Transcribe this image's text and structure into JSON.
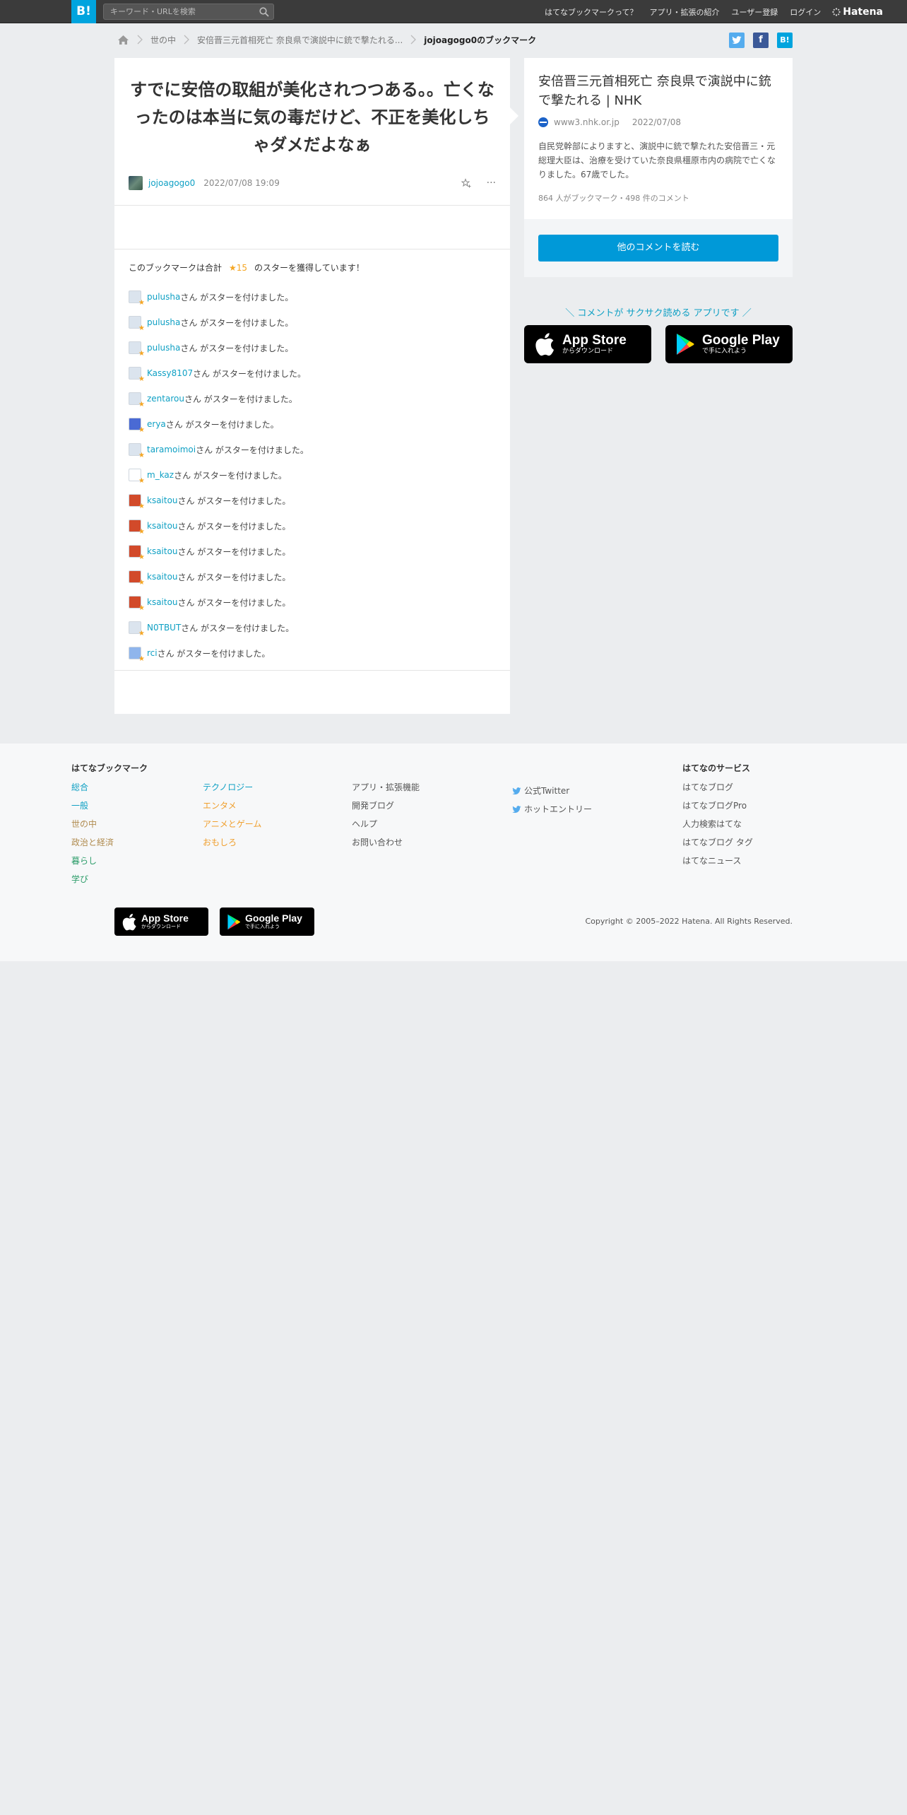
{
  "header": {
    "logo": "B!",
    "search_placeholder": "キーワード・URLを検索",
    "nav": [
      "はてなブックマークって？",
      "アプリ・拡張の紹介",
      "ユーザー登録",
      "ログイン"
    ],
    "brand": "Hatena"
  },
  "breadcrumb": {
    "items": [
      "世の中",
      "安倍晋三元首相死亡 奈良県で演説中に銃で撃たれる...",
      "jojoagogo0のブックマーク"
    ]
  },
  "share": {
    "twitter": "t",
    "facebook": "f",
    "hatena": "B!"
  },
  "bookmark": {
    "comment": "すでに安倍の取組が美化されつつある。。亡くなったのは本当に気の毒だけど、不正を美化しちゃダメだよなぁ",
    "user": "jojoagogo0",
    "date": "2022/07/08 19:09",
    "star_summary_pre": "このブックマークは合計",
    "star_count": "★15",
    "star_summary_post": "のスターを獲得しています！",
    "star_suffix": "さん がスターを付けました。",
    "stars": [
      {
        "user": "pulusha",
        "icon_color": "#dbe4ee"
      },
      {
        "user": "pulusha",
        "icon_color": "#dbe4ee"
      },
      {
        "user": "pulusha",
        "icon_color": "#dbe4ee"
      },
      {
        "user": "Kassy8107",
        "icon_color": "#dbe4ee"
      },
      {
        "user": "zentarou",
        "icon_color": "#dbe4ee"
      },
      {
        "user": "erya",
        "icon_color": "#4a6ad4"
      },
      {
        "user": "taramoimoi",
        "icon_color": "#dbe4ee"
      },
      {
        "user": "m_kaz",
        "icon_color": "#ffffff"
      },
      {
        "user": "ksaitou",
        "icon_color": "#d24a2a"
      },
      {
        "user": "ksaitou",
        "icon_color": "#d24a2a"
      },
      {
        "user": "ksaitou",
        "icon_color": "#d24a2a"
      },
      {
        "user": "ksaitou",
        "icon_color": "#d24a2a"
      },
      {
        "user": "ksaitou",
        "icon_color": "#d24a2a"
      },
      {
        "user": "N0TBUT",
        "icon_color": "#dbe4ee"
      },
      {
        "user": "rci",
        "icon_color": "#8fb5ec"
      }
    ]
  },
  "entry": {
    "title": "安倍晋三元首相死亡 奈良県で演説中に銃で撃たれる | NHK",
    "domain": "www3.nhk.or.jp",
    "date": "2022/07/08",
    "description": "自民党幹部によりますと、演説中に銃で撃たれた安倍晋三・元総理大臣は、治療を受けていた奈良県橿原市内の病院で亡くなりました。67歳でした。",
    "stats": "864 人がブックマーク・498 件のコメント",
    "read_more": "他のコメントを読む"
  },
  "promo": {
    "text": "＼ コメントが サクサク読める アプリです ／",
    "appstore_big": "App Store",
    "appstore_small": "からダウンロード",
    "gplay_big": "Google Play",
    "gplay_small": "で手に入れよう"
  },
  "footer": {
    "heading_bookmark": "はてなブックマーク",
    "categories_col1": [
      {
        "label": "総合",
        "color": "#0fa0c4"
      },
      {
        "label": "一般",
        "color": "#0fa0c4"
      },
      {
        "label": "世の中",
        "color": "#b08b4f"
      },
      {
        "label": "政治と経済",
        "color": "#b08b4f"
      },
      {
        "label": "暮らし",
        "color": "#2d9d6a"
      },
      {
        "label": "学び",
        "color": "#2d9d6a"
      }
    ],
    "categories_col2": [
      {
        "label": "テクノロジー",
        "color": "#0fa0c4"
      },
      {
        "label": "エンタメ",
        "color": "#f0a030"
      },
      {
        "label": "アニメとゲーム",
        "color": "#f0a030"
      },
      {
        "label": "おもしろ",
        "color": "#f0a030"
      }
    ],
    "links_col3": [
      "アプリ・拡張機能",
      "開発ブログ",
      "ヘルプ",
      "お問い合わせ"
    ],
    "links_col4": [
      "公式Twitter",
      "ホットエントリー"
    ],
    "heading_services": "はてなのサービス",
    "services": [
      "はてなブログ",
      "はてなブログPro",
      "人力検索はてな",
      "はてなブログ タグ",
      "はてなニュース"
    ],
    "copyright": "Copyright © 2005–2022 Hatena. All Rights Reserved."
  }
}
